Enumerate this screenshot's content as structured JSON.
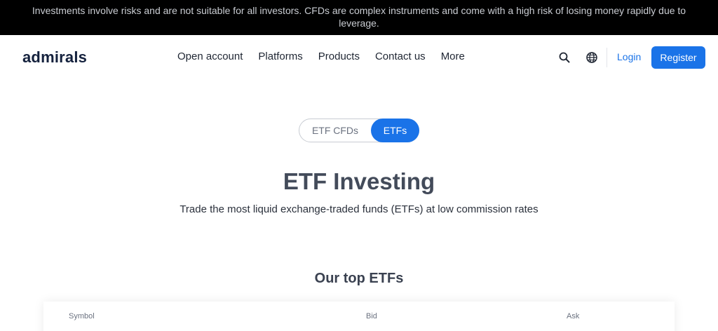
{
  "risk_banner": {
    "text": "Investments involve risks and are not suitable for all investors. CFDs are complex instruments and come with a high risk of losing money rapidly due to leverage."
  },
  "header": {
    "logo": "admirals",
    "nav": [
      {
        "label": "Open account"
      },
      {
        "label": "Platforms"
      },
      {
        "label": "Products"
      },
      {
        "label": "Contact us"
      },
      {
        "label": "More"
      }
    ],
    "icons": [
      "search-icon",
      "globe-icon"
    ],
    "login_label": "Login",
    "register_label": "Register"
  },
  "toggle": {
    "options": [
      {
        "label": "ETF CFDs",
        "active": false
      },
      {
        "label": "ETFs",
        "active": true
      }
    ]
  },
  "hero": {
    "title": "ETF Investing",
    "subtitle": "Trade the most liquid exchange-traded funds (ETFs) at low commission rates"
  },
  "top_etfs": {
    "title": "Our top ETFs",
    "columns": [
      "Symbol",
      "Bid",
      "Ask"
    ]
  },
  "colors": {
    "accent": "#1a73e8",
    "banner_bg": "#000000",
    "logo": "#14213d",
    "heading": "#434b5a"
  }
}
